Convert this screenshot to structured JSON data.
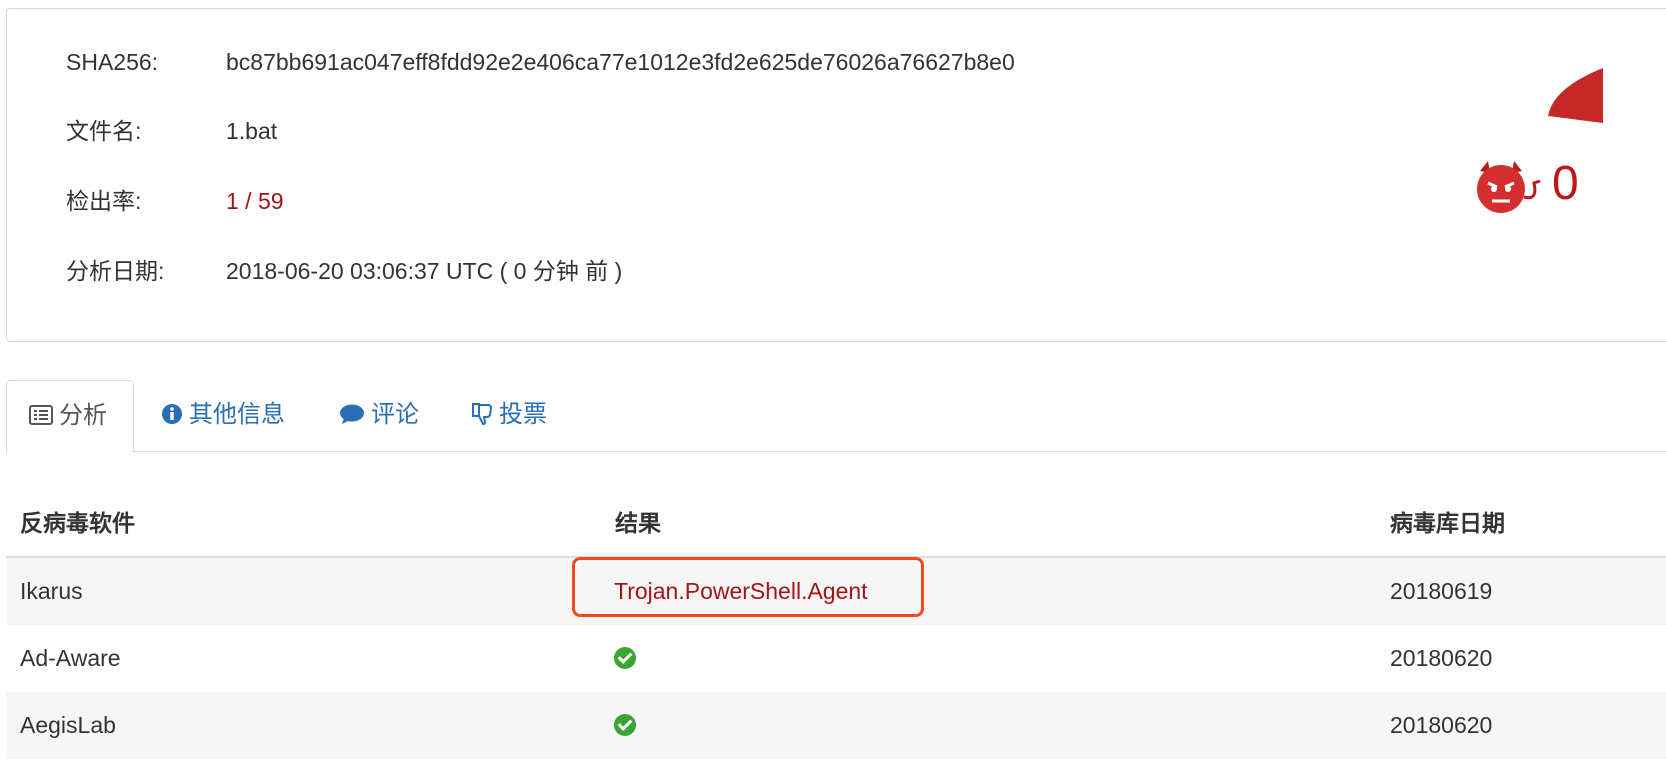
{
  "file_info": {
    "sha256_label": "SHA256:",
    "sha256_value": "bc87bb691ac047eff8fdd92e2e406ca77e1012e3fd2e625de76026a76627b8e0",
    "filename_label": "文件名:",
    "filename_value": "1.bat",
    "detection_label": "检出率:",
    "detection_value": "1 / 59",
    "date_label": "分析日期:",
    "date_value": "2018-06-20 03:06:37 UTC ( 0 分钟 前 )"
  },
  "score": {
    "partial_text": "0",
    "color": "#c0161b",
    "icon": "devil-face-icon"
  },
  "tabs": [
    {
      "label": "分析",
      "icon": "list-icon",
      "active": true
    },
    {
      "label": "其他信息",
      "icon": "info-circle-icon",
      "active": false
    },
    {
      "label": "评论",
      "icon": "comment-icon",
      "active": false
    },
    {
      "label": "投票",
      "icon": "thumbs-down-icon",
      "active": false
    }
  ],
  "table": {
    "headers": [
      "反病毒软件",
      "结果",
      "病毒库日期"
    ],
    "rows": [
      {
        "engine": "Ikarus",
        "result": "Trojan.PowerShell.Agent",
        "result_type": "detected",
        "date": "20180619"
      },
      {
        "engine": "Ad-Aware",
        "result": "",
        "result_type": "clean",
        "date": "20180620"
      },
      {
        "engine": "AegisLab",
        "result": "",
        "result_type": "clean",
        "date": "20180620"
      }
    ]
  },
  "colors": {
    "link_blue": "#2a6eb5",
    "danger_red": "#a31515",
    "highlight_orange": "#ee4b1e",
    "clean_green": "#3aa535"
  }
}
